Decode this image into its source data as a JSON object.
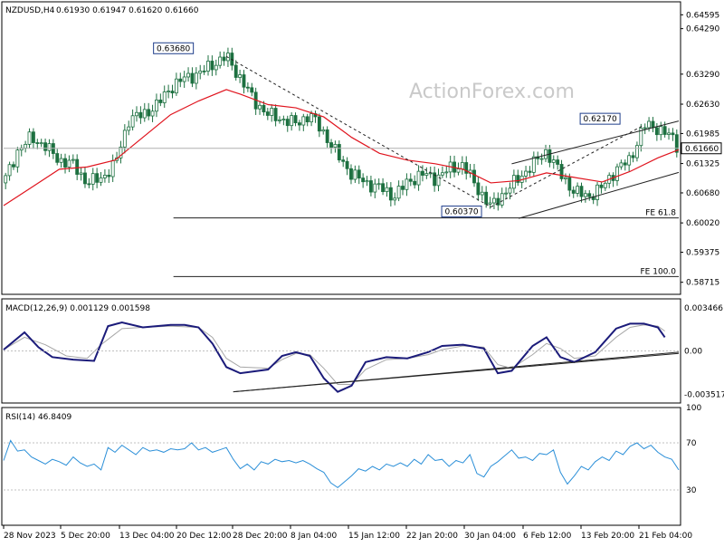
{
  "header": {
    "symbol": "NZDUSD,H4",
    "ohlc": "0.61930 0.61947 0.61620 0.61660"
  },
  "watermark": "ActionForex.com",
  "chart_data": [
    {
      "type": "candlestick",
      "title": "NZDUSD,H4",
      "ylim": [
        0.5845,
        0.6488
      ],
      "y_ticks": [
        "0.64595",
        "0.64290",
        "0.63290",
        "0.62630",
        "0.61985",
        "0.61325",
        "0.60680",
        "0.60020",
        "0.59375",
        "0.58715"
      ],
      "y_tick_values": [
        0.64595,
        0.6429,
        0.6329,
        0.6263,
        0.61985,
        0.61325,
        0.6068,
        0.6002,
        0.59375,
        0.58715
      ],
      "x_ticks": [
        "28 Nov 2023",
        "5 Dec 20:00",
        "13 Dec 04:00",
        "20 Dec 12:00",
        "28 Dec 20:00",
        "8 Jan 04:00",
        "15 Jan 12:00",
        "22 Jan 20:00",
        "30 Jan 04:00",
        "6 Feb 12:00",
        "13 Feb 20:00",
        "21 Feb 04:00"
      ],
      "current_price": "0.61660",
      "annotations": [
        {
          "label": "0.63680",
          "value": 0.6368
        },
        {
          "label": "0.60370",
          "value": 0.6037
        },
        {
          "label": "0.62170",
          "value": 0.6217
        },
        {
          "label": "FE 61.8",
          "value": 0.6013
        },
        {
          "label": "FE 100.0",
          "value": 0.5884
        }
      ],
      "close_path": [
        [
          0,
          0.609
        ],
        [
          2,
          0.616
        ],
        [
          4,
          0.619
        ],
        [
          6,
          0.617
        ],
        [
          8,
          0.614
        ],
        [
          10,
          0.613
        ],
        [
          12,
          0.609
        ],
        [
          14,
          0.61
        ],
        [
          16,
          0.613
        ],
        [
          18,
          0.623
        ],
        [
          20,
          0.624
        ],
        [
          22,
          0.626
        ],
        [
          24,
          0.63
        ],
        [
          26,
          0.632
        ],
        [
          28,
          0.633
        ],
        [
          30,
          0.635
        ],
        [
          32,
          0.6368
        ],
        [
          34,
          0.632
        ],
        [
          36,
          0.627
        ],
        [
          38,
          0.624
        ],
        [
          40,
          0.623
        ],
        [
          42,
          0.622
        ],
        [
          44,
          0.624
        ],
        [
          46,
          0.62
        ],
        [
          48,
          0.615
        ],
        [
          50,
          0.611
        ],
        [
          52,
          0.609
        ],
        [
          54,
          0.608
        ],
        [
          56,
          0.606
        ],
        [
          58,
          0.609
        ],
        [
          60,
          0.611
        ],
        [
          62,
          0.61
        ],
        [
          64,
          0.612
        ],
        [
          66,
          0.613
        ],
        [
          68,
          0.608
        ],
        [
          70,
          0.6037
        ],
        [
          72,
          0.607
        ],
        [
          74,
          0.61
        ],
        [
          76,
          0.613
        ],
        [
          78,
          0.616
        ],
        [
          80,
          0.611
        ],
        [
          82,
          0.607
        ],
        [
          84,
          0.606
        ],
        [
          86,
          0.608
        ],
        [
          88,
          0.612
        ],
        [
          90,
          0.614
        ],
        [
          92,
          0.6217
        ],
        [
          94,
          0.621
        ],
        [
          96,
          0.619
        ],
        [
          97,
          0.6166
        ]
      ],
      "series": [
        {
          "name": "",
          "color": "#e0141e",
          "values": [
            [
              0,
              0.604
            ],
            [
              4,
              0.608
            ],
            [
              8,
              0.612
            ],
            [
              12,
              0.6125
            ],
            [
              16,
              0.614
            ],
            [
              20,
              0.619
            ],
            [
              24,
              0.624
            ],
            [
              28,
              0.627
            ],
            [
              32,
              0.6295
            ],
            [
              34,
              0.6285
            ],
            [
              38,
              0.6262
            ],
            [
              42,
              0.6255
            ],
            [
              46,
              0.6235
            ],
            [
              50,
              0.619
            ],
            [
              54,
              0.6155
            ],
            [
              58,
              0.614
            ],
            [
              62,
              0.6132
            ],
            [
              66,
              0.612
            ],
            [
              70,
              0.609
            ],
            [
              74,
              0.6095
            ],
            [
              78,
              0.6112
            ],
            [
              82,
              0.6102
            ],
            [
              86,
              0.6092
            ],
            [
              90,
              0.6115
            ],
            [
              94,
              0.6145
            ],
            [
              97,
              0.6163
            ]
          ]
        }
      ]
    },
    {
      "type": "line",
      "title": "MACD(12,26,9) 0.001129 0.001598",
      "ylim": [
        -0.0042,
        0.0042
      ],
      "y_ticks": [
        "0.003466",
        "0.00",
        "-0.003517"
      ],
      "y_tick_values": [
        0.003466,
        0,
        -0.003517
      ],
      "series": [
        {
          "name": "",
          "color": "#1b1b7a",
          "values": [
            [
              0,
              0.0001
            ],
            [
              3,
              0.0015
            ],
            [
              5,
              0.0003
            ],
            [
              7,
              -0.0005
            ],
            [
              10,
              -0.0007
            ],
            [
              13,
              -0.0008
            ],
            [
              15,
              0.002
            ],
            [
              17,
              0.0023
            ],
            [
              20,
              0.0019
            ],
            [
              24,
              0.0021
            ],
            [
              26,
              0.0021
            ],
            [
              28,
              0.0019
            ],
            [
              30,
              0.0006
            ],
            [
              32,
              -0.0013
            ],
            [
              34,
              -0.0018
            ],
            [
              38,
              -0.0015
            ],
            [
              40,
              -0.0004
            ],
            [
              42,
              -0.0001
            ],
            [
              44,
              -0.0004
            ],
            [
              46,
              -0.0022
            ],
            [
              48,
              -0.0033
            ],
            [
              50,
              -0.0028
            ],
            [
              52,
              -0.0009
            ],
            [
              55,
              -0.0005
            ],
            [
              58,
              -0.0006
            ],
            [
              61,
              -0.0001
            ],
            [
              63,
              0.0004
            ],
            [
              66,
              0.0005
            ],
            [
              69,
              0.0002
            ],
            [
              71,
              -0.0018
            ],
            [
              73,
              -0.0016
            ],
            [
              76,
              0.0004
            ],
            [
              78,
              0.0011
            ],
            [
              80,
              -0.0005
            ],
            [
              82,
              -0.0009
            ],
            [
              85,
              -0.0001
            ],
            [
              88,
              0.0018
            ],
            [
              90,
              0.0022
            ],
            [
              92,
              0.0022
            ],
            [
              94,
              0.0019
            ],
            [
              95,
              0.0011
            ]
          ]
        },
        {
          "name": "",
          "color": "#a7a7a7",
          "values": [
            [
              0,
              0.0001
            ],
            [
              3,
              0.0011
            ],
            [
              6,
              0.0005
            ],
            [
              9,
              -0.0004
            ],
            [
              12,
              -0.0006
            ],
            [
              14,
              0.0005
            ],
            [
              17,
              0.0018
            ],
            [
              20,
              0.0019
            ],
            [
              24,
              0.002
            ],
            [
              28,
              0.0019
            ],
            [
              30,
              0.0011
            ],
            [
              32,
              -0.0006
            ],
            [
              34,
              -0.0013
            ],
            [
              38,
              -0.0014
            ],
            [
              40,
              -0.0007
            ],
            [
              42,
              -0.0002
            ],
            [
              44,
              -0.0003
            ],
            [
              46,
              -0.0014
            ],
            [
              48,
              -0.0027
            ],
            [
              50,
              -0.0027
            ],
            [
              52,
              -0.0015
            ],
            [
              55,
              -0.0007
            ],
            [
              58,
              -0.0006
            ],
            [
              61,
              -0.0003
            ],
            [
              63,
              0.0001
            ],
            [
              66,
              0.0004
            ],
            [
              69,
              0.0003
            ],
            [
              71,
              -0.0011
            ],
            [
              73,
              -0.0014
            ],
            [
              76,
              -0.0003
            ],
            [
              78,
              0.0006
            ],
            [
              80,
              0.0002
            ],
            [
              82,
              -0.0006
            ],
            [
              85,
              -0.0004
            ],
            [
              88,
              0.0011
            ],
            [
              90,
              0.0019
            ],
            [
              92,
              0.0021
            ],
            [
              94,
              0.002
            ],
            [
              95,
              0.0016
            ]
          ]
        }
      ]
    },
    {
      "type": "line",
      "title": "RSI(14) 46.8409",
      "ylim": [
        0,
        100
      ],
      "y_ticks": [
        "100",
        "70",
        "30",
        "0"
      ],
      "y_tick_values": [
        100,
        70,
        30,
        0
      ],
      "series": [
        {
          "name": "",
          "color": "#2b8fd8",
          "values": [
            [
              0,
              55
            ],
            [
              1,
              72
            ],
            [
              2,
              63
            ],
            [
              3,
              64
            ],
            [
              4,
              58
            ],
            [
              5,
              55
            ],
            [
              6,
              52
            ],
            [
              7,
              56
            ],
            [
              8,
              54
            ],
            [
              9,
              51
            ],
            [
              10,
              58
            ],
            [
              11,
              53
            ],
            [
              12,
              50
            ],
            [
              13,
              52
            ],
            [
              14,
              47
            ],
            [
              15,
              66
            ],
            [
              16,
              62
            ],
            [
              17,
              68
            ],
            [
              18,
              64
            ],
            [
              19,
              60
            ],
            [
              20,
              66
            ],
            [
              21,
              63
            ],
            [
              22,
              64
            ],
            [
              23,
              62
            ],
            [
              24,
              65
            ],
            [
              25,
              64
            ],
            [
              26,
              65
            ],
            [
              27,
              70
            ],
            [
              28,
              64
            ],
            [
              29,
              66
            ],
            [
              30,
              62
            ],
            [
              31,
              64
            ],
            [
              32,
              66
            ],
            [
              33,
              56
            ],
            [
              34,
              48
            ],
            [
              35,
              52
            ],
            [
              36,
              47
            ],
            [
              37,
              54
            ],
            [
              38,
              52
            ],
            [
              39,
              56
            ],
            [
              40,
              54
            ],
            [
              41,
              55
            ],
            [
              42,
              53
            ],
            [
              43,
              55
            ],
            [
              44,
              52
            ],
            [
              45,
              48
            ],
            [
              46,
              45
            ],
            [
              47,
              36
            ],
            [
              48,
              32
            ],
            [
              49,
              37
            ],
            [
              50,
              42
            ],
            [
              51,
              48
            ],
            [
              52,
              46
            ],
            [
              53,
              50
            ],
            [
              54,
              47
            ],
            [
              55,
              52
            ],
            [
              56,
              50
            ],
            [
              57,
              53
            ],
            [
              58,
              50
            ],
            [
              59,
              56
            ],
            [
              60,
              52
            ],
            [
              61,
              60
            ],
            [
              62,
              55
            ],
            [
              63,
              56
            ],
            [
              64,
              50
            ],
            [
              65,
              55
            ],
            [
              66,
              53
            ],
            [
              67,
              60
            ],
            [
              68,
              44
            ],
            [
              69,
              41
            ],
            [
              70,
              50
            ],
            [
              71,
              54
            ],
            [
              72,
              59
            ],
            [
              73,
              64
            ],
            [
              74,
              57
            ],
            [
              75,
              58
            ],
            [
              76,
              55
            ],
            [
              77,
              61
            ],
            [
              78,
              60
            ],
            [
              79,
              64
            ],
            [
              80,
              45
            ],
            [
              81,
              35
            ],
            [
              82,
              42
            ],
            [
              83,
              50
            ],
            [
              84,
              47
            ],
            [
              85,
              54
            ],
            [
              86,
              58
            ],
            [
              87,
              55
            ],
            [
              88,
              63
            ],
            [
              89,
              60
            ],
            [
              90,
              67
            ],
            [
              91,
              70
            ],
            [
              92,
              65
            ],
            [
              93,
              68
            ],
            [
              94,
              62
            ],
            [
              95,
              58
            ],
            [
              96,
              56
            ],
            [
              97,
              47
            ]
          ]
        }
      ],
      "levels": [
        70,
        30
      ]
    }
  ]
}
